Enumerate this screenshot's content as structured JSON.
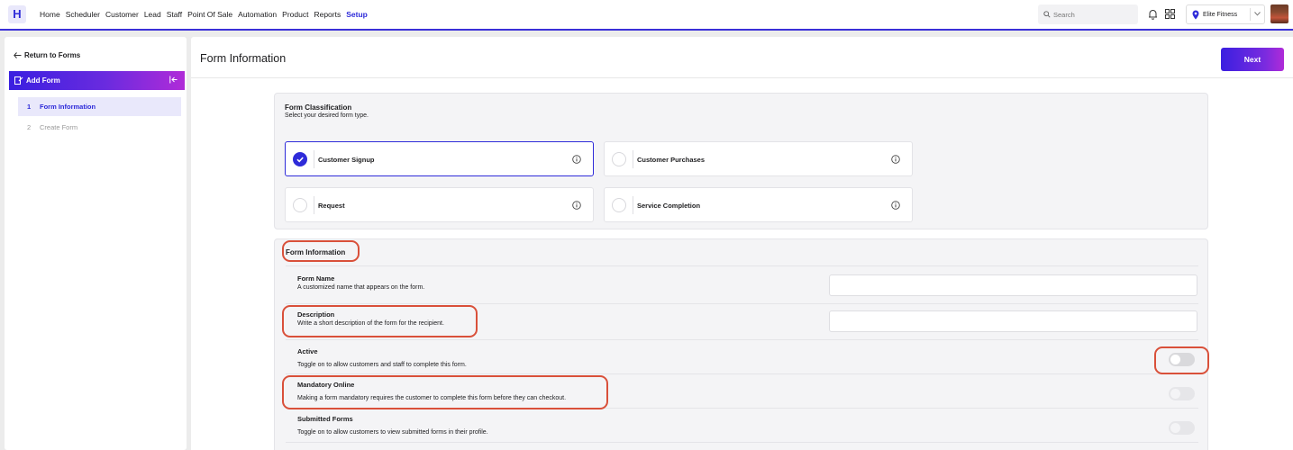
{
  "topbar": {
    "logo": "H",
    "nav": [
      "Home",
      "Scheduler",
      "Customer",
      "Lead",
      "Staff",
      "Point Of Sale",
      "Automation",
      "Product",
      "Reports",
      "Setup"
    ],
    "active_nav": "Setup",
    "search_placeholder": "Search",
    "location": "Elite Fitness",
    "accent": "#2e2bd9"
  },
  "sidebar": {
    "return_label": "Return to Forms",
    "section_label": "Add Form",
    "steps": [
      {
        "num": "1",
        "label": "Form Information",
        "active": true
      },
      {
        "num": "2",
        "label": "Create Form",
        "active": false
      }
    ]
  },
  "header": {
    "title": "Form Information",
    "next_label": "Next"
  },
  "classification": {
    "title": "Form Classification",
    "subtitle": "Select your desired form type.",
    "options": [
      {
        "label": "Customer Signup",
        "selected": true
      },
      {
        "label": "Customer Purchases",
        "selected": false
      },
      {
        "label": "Request",
        "selected": false
      },
      {
        "label": "Service Completion",
        "selected": false
      }
    ]
  },
  "form_info": {
    "title": "Form Information",
    "rows": [
      {
        "title": "Form Name",
        "desc": "A customized name that appears on the form.",
        "control": "text"
      },
      {
        "title": "Description",
        "desc": "Write a short description of the form for the recipient.",
        "control": "text"
      },
      {
        "title": "Active",
        "desc": "Toggle on to allow customers and staff to complete this form.",
        "control": "toggle",
        "on": false
      },
      {
        "title": "Mandatory Online",
        "desc": "Making a form mandatory requires the customer to complete this form before they can checkout.",
        "control": "toggle",
        "on": false,
        "disabled": true
      },
      {
        "title": "Submitted Forms",
        "desc": "Toggle on to allow customers to view submitted forms in their profile.",
        "control": "toggle",
        "on": false,
        "disabled": true
      }
    ]
  },
  "highlight_color": "#d9503a"
}
